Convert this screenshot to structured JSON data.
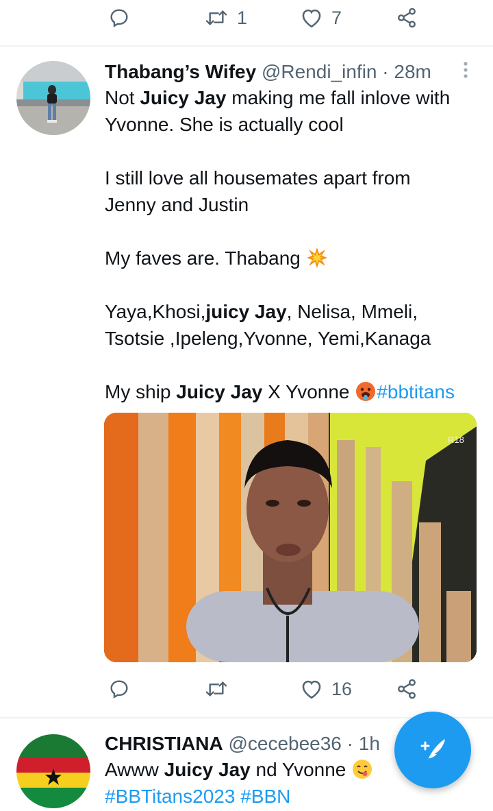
{
  "top_actions": {
    "reply_count": "",
    "retweet_count": "1",
    "like_count": "7"
  },
  "tweet1": {
    "display_name": "Thabang’s Wifey",
    "handle": "@Rendi_infin",
    "separator": " · ",
    "time": "28m",
    "lines": {
      "l1a": "Not ",
      "l1b": "Juicy Jay",
      "l1c": " making me fall inlove with",
      "l2": "Yvonne. She is actually cool",
      "l3": "I still love all housemates apart from",
      "l4": "Jenny and Justin",
      "l5": "My faves are. Thabang ",
      "l6a": "Yaya,Khosi,",
      "l6b": "juicy Jay",
      "l6c": ", Nelisa, Mmeli,",
      "l7": "Tsotsie ,Ipeleng,Yvonne, Yemi,Kanaga",
      "l8a": "My ship ",
      "l8b": "Juicy Jay",
      "l8c": " X Yvonne ",
      "l8d": "#bbtitans"
    },
    "media_badge": "R18",
    "actions": {
      "reply_count": "",
      "retweet_count": "",
      "like_count": "16"
    }
  },
  "tweet2": {
    "display_name": "CHRISTIANA",
    "handle": "@cecebee36",
    "separator": " · ",
    "time": "1h",
    "lines": {
      "l1a": "Awww ",
      "l1b": "Juicy Jay",
      "l1c": " nd Yvonne ",
      "l2": "#BBTitans2023 #BBN"
    }
  },
  "icons": [
    "reply-icon",
    "retweet-icon",
    "like-icon",
    "share-icon",
    "more-icon",
    "compose-icon",
    "explosion-emoji",
    "hot-face-emoji",
    "yum-emoji"
  ],
  "colors": {
    "accent": "#1d9bf0",
    "text": "#0f1419",
    "secondary": "#536471",
    "divider": "#eff3f4"
  }
}
